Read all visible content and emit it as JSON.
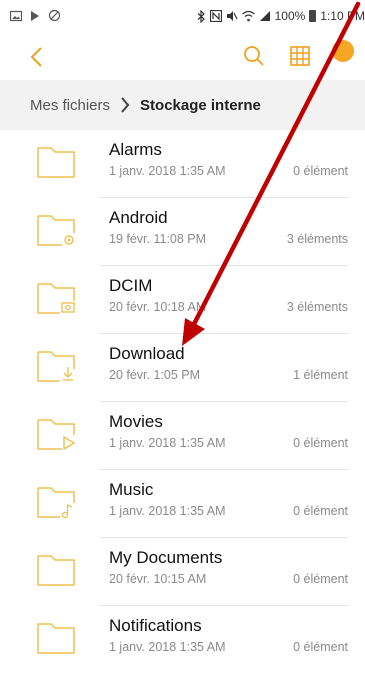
{
  "status_bar": {
    "left_icons": [
      "picture-icon",
      "play-store-icon",
      "blocked-icon"
    ],
    "battery": "100%",
    "time": "1:10 PM"
  },
  "app_bar": {
    "back_icon": "chevron-left-icon",
    "actions": [
      "search-icon",
      "grid-view-icon",
      "notification-badge-icon"
    ],
    "accent_color": "#f0a020"
  },
  "breadcrumb": {
    "root": "Mes fichiers",
    "current": "Stockage interne"
  },
  "files": [
    {
      "name": "Alarms",
      "date": "1 janv. 2018 1:35 AM",
      "count": "0 élément",
      "icon": "folder-icon"
    },
    {
      "name": "Android",
      "date": "19 févr. 11:08 PM",
      "count": "3 éléments",
      "icon": "folder-settings-icon"
    },
    {
      "name": "DCIM",
      "date": "20 févr. 10:18 AM",
      "count": "3 éléments",
      "icon": "folder-camera-icon"
    },
    {
      "name": "Download",
      "date": "20 févr. 1:05 PM",
      "count": "1 élément",
      "icon": "folder-download-icon"
    },
    {
      "name": "Movies",
      "date": "1 janv. 2018 1:35 AM",
      "count": "0 élément",
      "icon": "folder-video-icon"
    },
    {
      "name": "Music",
      "date": "1 janv. 2018 1:35 AM",
      "count": "0 élément",
      "icon": "folder-music-icon"
    },
    {
      "name": "My Documents",
      "date": "20 févr. 10:15 AM",
      "count": "0 élément",
      "icon": "folder-icon"
    },
    {
      "name": "Notifications",
      "date": "1 janv. 2018 1:35 AM",
      "count": "0 élément",
      "icon": "folder-icon"
    }
  ],
  "annotation": {
    "type": "arrow",
    "color": "#c00000",
    "points_to": "Download"
  }
}
